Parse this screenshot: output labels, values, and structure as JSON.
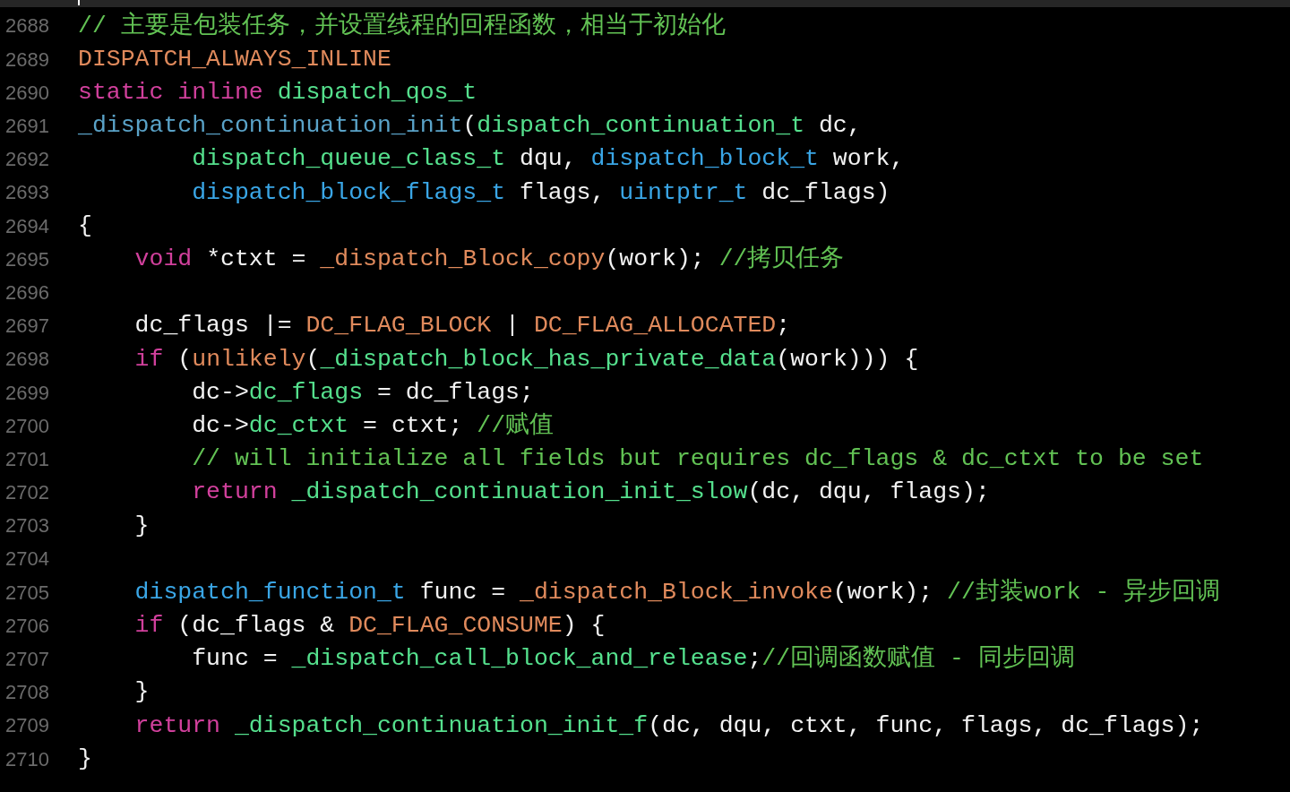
{
  "lines": [
    {
      "number": "2688",
      "tokens": [
        {
          "kind": "comment",
          "text": "// 主要是包装任务，并设置线程的回程函数，相当于初始化"
        }
      ]
    },
    {
      "number": "2689",
      "tokens": [
        {
          "kind": "macro",
          "text": "DISPATCH_ALWAYS_INLINE"
        }
      ]
    },
    {
      "number": "2690",
      "tokens": [
        {
          "kind": "keyword",
          "text": "static inline "
        },
        {
          "kind": "type",
          "text": "dispatch_qos_t"
        }
      ]
    },
    {
      "number": "2691",
      "tokens": [
        {
          "kind": "decl",
          "text": "_dispatch_continuation_init"
        },
        {
          "kind": "plain",
          "text": "("
        },
        {
          "kind": "type",
          "text": "dispatch_continuation_t"
        },
        {
          "kind": "plain",
          "text": " dc,"
        }
      ]
    },
    {
      "number": "2692",
      "tokens": [
        {
          "kind": "type",
          "text": "        dispatch_queue_class_t"
        },
        {
          "kind": "plain",
          "text": " dqu, "
        },
        {
          "kind": "blue",
          "text": "dispatch_block_t"
        },
        {
          "kind": "plain",
          "text": " work,"
        }
      ]
    },
    {
      "number": "2693",
      "tokens": [
        {
          "kind": "blue",
          "text": "        dispatch_block_flags_t"
        },
        {
          "kind": "plain",
          "text": " flags, "
        },
        {
          "kind": "blue",
          "text": "uintptr_t"
        },
        {
          "kind": "plain",
          "text": " dc_flags)"
        }
      ]
    },
    {
      "number": "2694",
      "tokens": [
        {
          "kind": "plain",
          "text": "{"
        }
      ]
    },
    {
      "number": "2695",
      "tokens": [
        {
          "kind": "keyword",
          "text": "    void"
        },
        {
          "kind": "plain",
          "text": " *ctxt = "
        },
        {
          "kind": "macro",
          "text": "_dispatch_Block_copy"
        },
        {
          "kind": "plain",
          "text": "(work); "
        },
        {
          "kind": "comment",
          "text": "//拷贝任务"
        }
      ]
    },
    {
      "number": "2696"
    },
    {
      "number": "2697",
      "tokens": [
        {
          "kind": "plain",
          "text": "    dc_flags |= "
        },
        {
          "kind": "macro",
          "text": "DC_FLAG_BLOCK"
        },
        {
          "kind": "plain",
          "text": " | "
        },
        {
          "kind": "macro",
          "text": "DC_FLAG_ALLOCATED"
        },
        {
          "kind": "plain",
          "text": ";"
        }
      ]
    },
    {
      "number": "2698",
      "tokens": [
        {
          "kind": "keyword",
          "text": "    if"
        },
        {
          "kind": "plain",
          "text": " ("
        },
        {
          "kind": "macro",
          "text": "unlikely"
        },
        {
          "kind": "plain",
          "text": "("
        },
        {
          "kind": "type",
          "text": "_dispatch_block_has_private_data"
        },
        {
          "kind": "plain",
          "text": "(work))) {"
        }
      ]
    },
    {
      "number": "2699",
      "tokens": [
        {
          "kind": "plain",
          "text": "        dc->"
        },
        {
          "kind": "type",
          "text": "dc_flags"
        },
        {
          "kind": "plain",
          "text": " = dc_flags;"
        }
      ]
    },
    {
      "number": "2700",
      "tokens": [
        {
          "kind": "plain",
          "text": "        dc->"
        },
        {
          "kind": "type",
          "text": "dc_ctxt"
        },
        {
          "kind": "plain",
          "text": " = ctxt; "
        },
        {
          "kind": "comment",
          "text": "//赋值"
        }
      ]
    },
    {
      "number": "2701",
      "tokens": [
        {
          "kind": "comment",
          "text": "        // will initialize all fields but requires dc_flags & dc_ctxt to be set"
        }
      ]
    },
    {
      "number": "2702",
      "tokens": [
        {
          "kind": "keyword",
          "text": "        return "
        },
        {
          "kind": "type",
          "text": "_dispatch_continuation_init_slow"
        },
        {
          "kind": "plain",
          "text": "(dc, dqu, flags);"
        }
      ]
    },
    {
      "number": "2703",
      "tokens": [
        {
          "kind": "plain",
          "text": "    }"
        }
      ]
    },
    {
      "number": "2704"
    },
    {
      "number": "2705",
      "tokens": [
        {
          "kind": "blue",
          "text": "    dispatch_function_t"
        },
        {
          "kind": "plain",
          "text": " func = "
        },
        {
          "kind": "macro",
          "text": "_dispatch_Block_invoke"
        },
        {
          "kind": "plain",
          "text": "(work); "
        },
        {
          "kind": "comment",
          "text": "//封装work - 异步回调"
        }
      ]
    },
    {
      "number": "2706",
      "tokens": [
        {
          "kind": "keyword",
          "text": "    if"
        },
        {
          "kind": "plain",
          "text": " (dc_flags & "
        },
        {
          "kind": "macro",
          "text": "DC_FLAG_CONSUME"
        },
        {
          "kind": "plain",
          "text": ") {"
        }
      ]
    },
    {
      "number": "2707",
      "tokens": [
        {
          "kind": "plain",
          "text": "        func = "
        },
        {
          "kind": "type",
          "text": "_dispatch_call_block_and_release"
        },
        {
          "kind": "plain",
          "text": ";"
        },
        {
          "kind": "comment",
          "text": "//回调函数赋值 - 同步回调"
        }
      ]
    },
    {
      "number": "2708",
      "tokens": [
        {
          "kind": "plain",
          "text": "    }"
        }
      ]
    },
    {
      "number": "2709",
      "tokens": [
        {
          "kind": "keyword",
          "text": "    return "
        },
        {
          "kind": "type",
          "text": "_dispatch_continuation_init_f"
        },
        {
          "kind": "plain",
          "text": "(dc, dqu, ctxt, func, flags, dc_flags);"
        }
      ]
    },
    {
      "number": "2710",
      "tokens": [
        {
          "kind": "plain",
          "text": "}"
        }
      ]
    }
  ]
}
